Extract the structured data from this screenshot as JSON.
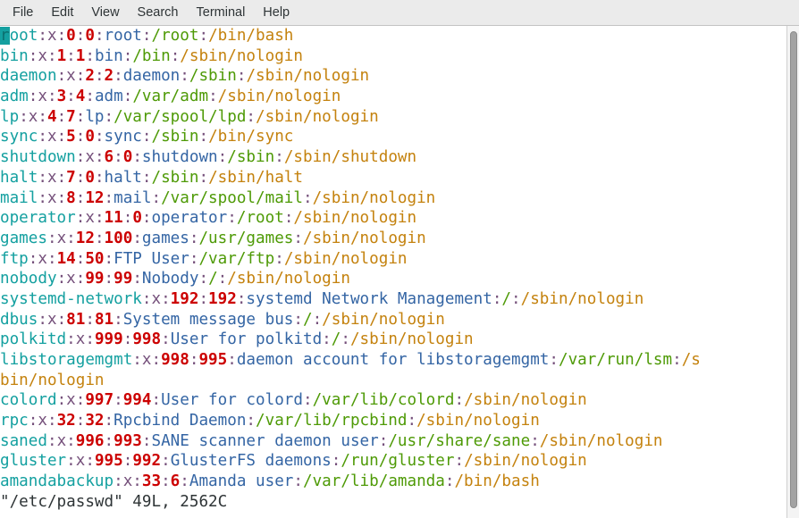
{
  "window": {
    "background": "#ffffff",
    "foreground": "#2e3436"
  },
  "menubar": {
    "items": [
      {
        "label": "File"
      },
      {
        "label": "Edit"
      },
      {
        "label": "View"
      },
      {
        "label": "Search"
      },
      {
        "label": "Terminal"
      },
      {
        "label": "Help"
      }
    ]
  },
  "colors": {
    "username": "#14a0a0",
    "separator": "#75507b",
    "uid_gid": "#cc0000",
    "gecos": "#3465a4",
    "home": "#4e9a06",
    "shell": "#c4820e",
    "cursor_block": "#14a0a0",
    "menubar_bg": "#ebebeb",
    "scrollbar_thumb": "#a3a3a3"
  },
  "cursor": {
    "char": "r",
    "row": 0,
    "column": 0
  },
  "editor": {
    "file_name": "/etc/passwd",
    "status_line": "\"/etc/passwd\" 49L, 2562C",
    "line_count": "49L",
    "byte_count": "2562C"
  },
  "terminal": {
    "lines": [
      {
        "user": "root",
        "sep1": ":",
        "x": "x",
        "sep2": ":",
        "uid": "0",
        "sep3": ":",
        "gid": "0",
        "sep4": ":",
        "gecos": "root",
        "sep5": ":",
        "home": "/root",
        "sep6": ":",
        "shell": "/bin/bash",
        "cursor": true
      },
      {
        "user": "bin",
        "sep1": ":",
        "x": "x",
        "sep2": ":",
        "uid": "1",
        "sep3": ":",
        "gid": "1",
        "sep4": ":",
        "gecos": "bin",
        "sep5": ":",
        "home": "/bin",
        "sep6": ":",
        "shell": "/sbin/nologin"
      },
      {
        "user": "daemon",
        "sep1": ":",
        "x": "x",
        "sep2": ":",
        "uid": "2",
        "sep3": ":",
        "gid": "2",
        "sep4": ":",
        "gecos": "daemon",
        "sep5": ":",
        "home": "/sbin",
        "sep6": ":",
        "shell": "/sbin/nologin"
      },
      {
        "user": "adm",
        "sep1": ":",
        "x": "x",
        "sep2": ":",
        "uid": "3",
        "sep3": ":",
        "gid": "4",
        "sep4": ":",
        "gecos": "adm",
        "sep5": ":",
        "home": "/var/adm",
        "sep6": ":",
        "shell": "/sbin/nologin"
      },
      {
        "user": "lp",
        "sep1": ":",
        "x": "x",
        "sep2": ":",
        "uid": "4",
        "sep3": ":",
        "gid": "7",
        "sep4": ":",
        "gecos": "lp",
        "sep5": ":",
        "home": "/var/spool/lpd",
        "sep6": ":",
        "shell": "/sbin/nologin"
      },
      {
        "user": "sync",
        "sep1": ":",
        "x": "x",
        "sep2": ":",
        "uid": "5",
        "sep3": ":",
        "gid": "0",
        "sep4": ":",
        "gecos": "sync",
        "sep5": ":",
        "home": "/sbin",
        "sep6": ":",
        "shell": "/bin/sync"
      },
      {
        "user": "shutdown",
        "sep1": ":",
        "x": "x",
        "sep2": ":",
        "uid": "6",
        "sep3": ":",
        "gid": "0",
        "sep4": ":",
        "gecos": "shutdown",
        "sep5": ":",
        "home": "/sbin",
        "sep6": ":",
        "shell": "/sbin/shutdown"
      },
      {
        "user": "halt",
        "sep1": ":",
        "x": "x",
        "sep2": ":",
        "uid": "7",
        "sep3": ":",
        "gid": "0",
        "sep4": ":",
        "gecos": "halt",
        "sep5": ":",
        "home": "/sbin",
        "sep6": ":",
        "shell": "/sbin/halt"
      },
      {
        "user": "mail",
        "sep1": ":",
        "x": "x",
        "sep2": ":",
        "uid": "8",
        "sep3": ":",
        "gid": "12",
        "sep4": ":",
        "gecos": "mail",
        "sep5": ":",
        "home": "/var/spool/mail",
        "sep6": ":",
        "shell": "/sbin/nologin"
      },
      {
        "user": "operator",
        "sep1": ":",
        "x": "x",
        "sep2": ":",
        "uid": "11",
        "sep3": ":",
        "gid": "0",
        "sep4": ":",
        "gecos": "operator",
        "sep5": ":",
        "home": "/root",
        "sep6": ":",
        "shell": "/sbin/nologin"
      },
      {
        "user": "games",
        "sep1": ":",
        "x": "x",
        "sep2": ":",
        "uid": "12",
        "sep3": ":",
        "gid": "100",
        "sep4": ":",
        "gecos": "games",
        "sep5": ":",
        "home": "/usr/games",
        "sep6": ":",
        "shell": "/sbin/nologin"
      },
      {
        "user": "ftp",
        "sep1": ":",
        "x": "x",
        "sep2": ":",
        "uid": "14",
        "sep3": ":",
        "gid": "50",
        "sep4": ":",
        "gecos": "FTP User",
        "sep5": ":",
        "home": "/var/ftp",
        "sep6": ":",
        "shell": "/sbin/nologin"
      },
      {
        "user": "nobody",
        "sep1": ":",
        "x": "x",
        "sep2": ":",
        "uid": "99",
        "sep3": ":",
        "gid": "99",
        "sep4": ":",
        "gecos": "Nobody",
        "sep5": ":",
        "home": "/",
        "sep6": ":",
        "shell": "/sbin/nologin"
      },
      {
        "user": "systemd-network",
        "sep1": ":",
        "x": "x",
        "sep2": ":",
        "uid": "192",
        "sep3": ":",
        "gid": "192",
        "sep4": ":",
        "gecos": "systemd Network Management",
        "sep5": ":",
        "home": "/",
        "sep6": ":",
        "shell": "/sbin/nologin"
      },
      {
        "user": "dbus",
        "sep1": ":",
        "x": "x",
        "sep2": ":",
        "uid": "81",
        "sep3": ":",
        "gid": "81",
        "sep4": ":",
        "gecos": "System message bus",
        "sep5": ":",
        "home": "/",
        "sep6": ":",
        "shell": "/sbin/nologin"
      },
      {
        "user": "polkitd",
        "sep1": ":",
        "x": "x",
        "sep2": ":",
        "uid": "999",
        "sep3": ":",
        "gid": "998",
        "sep4": ":",
        "gecos": "User for polkitd",
        "sep5": ":",
        "home": "/",
        "sep6": ":",
        "shell": "/sbin/nologin"
      },
      {
        "user": "libstoragemgmt",
        "sep1": ":",
        "x": "x",
        "sep2": ":",
        "uid": "998",
        "sep3": ":",
        "gid": "995",
        "sep4": ":",
        "gecos": "daemon account for libstoragemgmt",
        "sep5": ":",
        "home": "/var/run/lsm",
        "sep6": ":",
        "shell": "/sbin/nologin",
        "wraps": true
      },
      {
        "user": "colord",
        "sep1": ":",
        "x": "x",
        "sep2": ":",
        "uid": "997",
        "sep3": ":",
        "gid": "994",
        "sep4": ":",
        "gecos": "User for colord",
        "sep5": ":",
        "home": "/var/lib/colord",
        "sep6": ":",
        "shell": "/sbin/nologin"
      },
      {
        "user": "rpc",
        "sep1": ":",
        "x": "x",
        "sep2": ":",
        "uid": "32",
        "sep3": ":",
        "gid": "32",
        "sep4": ":",
        "gecos": "Rpcbind Daemon",
        "sep5": ":",
        "home": "/var/lib/rpcbind",
        "sep6": ":",
        "shell": "/sbin/nologin"
      },
      {
        "user": "saned",
        "sep1": ":",
        "x": "x",
        "sep2": ":",
        "uid": "996",
        "sep3": ":",
        "gid": "993",
        "sep4": ":",
        "gecos": "SANE scanner daemon user",
        "sep5": ":",
        "home": "/usr/share/sane",
        "sep6": ":",
        "shell": "/sbin/nologin"
      },
      {
        "user": "gluster",
        "sep1": ":",
        "x": "x",
        "sep2": ":",
        "uid": "995",
        "sep3": ":",
        "gid": "992",
        "sep4": ":",
        "gecos": "GlusterFS daemons",
        "sep5": ":",
        "home": "/run/gluster",
        "sep6": ":",
        "shell": "/sbin/nologin"
      },
      {
        "user": "amandabackup",
        "sep1": ":",
        "x": "x",
        "sep2": ":",
        "uid": "33",
        "sep3": ":",
        "gid": "6",
        "sep4": ":",
        "gecos": "Amanda user",
        "sep5": ":",
        "home": "/var/lib/amanda",
        "sep6": ":",
        "shell": "/bin/bash"
      }
    ]
  },
  "scrollbar": {
    "thumb_top_pct": 1,
    "thumb_height_pct": 97
  }
}
